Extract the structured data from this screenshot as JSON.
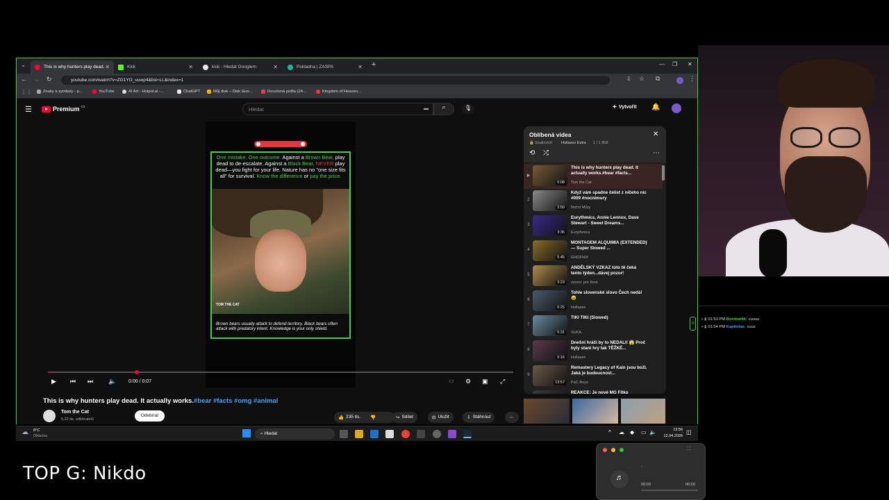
{
  "browser": {
    "tabs": [
      {
        "label": "This is why hunters play dead. ",
        "color": "#ff0033",
        "active": true
      },
      {
        "label": "Kick",
        "color": "#53fc18",
        "active": false
      },
      {
        "label": "kick - Hledat Googlem",
        "color": "#e8e8e8",
        "active": false
      },
      {
        "label": "Pokladna | ZASPA",
        "color": "#1fb0a8",
        "active": false
      }
    ],
    "new_tab_label": "+",
    "url": "youtube.com/watch?v=ZG1YO_uuwp4&list=LL&index=1",
    "bookmarks": [
      "Znaky a symboly - p...",
      "YouTube",
      "AI Art - Hotpot.ai -...",
      "ChatGPT",
      "Můj disk – Disk Goo...",
      "Doručená pošta (24...",
      "Kingdom of Heaven..."
    ]
  },
  "youtube": {
    "logo_text": "Premium",
    "logo_superscript": "CZ",
    "search_placeholder": "Hledat",
    "create_label": "Vytvořit",
    "video": {
      "overlay_text_1": "One mistake. One outcome.",
      "overlay_text_2": " Against a ",
      "overlay_text_3": "Brown Bear,",
      "overlay_text_4": " play dead to de-escalate. Against a ",
      "overlay_text_5": "Black Bear,",
      "overlay_text_6": " NEVER",
      "overlay_text_7": " play dead—you fight for your life. Nature has no \"one size fits all\" for survival. ",
      "overlay_text_8": "Know the difference",
      "overlay_text_9": " or ",
      "overlay_text_10": "pay the price.",
      "watermark": "TOM THE CAT",
      "caption": "Brown bears usually attack to defend territory. Black bears often attack with predatory intent. Knowledge is your only shield.",
      "time": "0:00 / 0:07",
      "progress_fraction": 0.005
    },
    "title_main": "This is why hunters play dead. It actually works.",
    "title_tags": "#bear #facts #omg #animal",
    "channel_name": "Tom the Cat",
    "subscribers": "5,22 tis. odběratelů",
    "subscribe_label": "Odebírat",
    "likes": "235 tis.",
    "share_label": "Sdílet",
    "save_label": "Uložit",
    "download_label": "Stáhnout"
  },
  "playlist": {
    "title": "Oblíbená videa",
    "privacy": "Soukromé",
    "owner": "Hollasen Extra",
    "position": "1 / 1 858",
    "items": [
      {
        "idx": "▶",
        "title": "This is why hunters play dead. It actually works.#bear #facts...",
        "channel": "Tom the Cat",
        "duration": "0:08",
        "color": "#7a5a3a"
      },
      {
        "idx": "2",
        "title": "Když vám spadne čelist z ničeho nic #009 #nocnimury",
        "channel": "Noční Můry",
        "duration": "2:50",
        "color": "#8a8a8a"
      },
      {
        "idx": "3",
        "title": "Eurythmics, Annie Lennox, Dave Stewart - Sweet Dreams...",
        "channel": "Eurythmics",
        "duration": "3:35",
        "color": "#3a2a8a"
      },
      {
        "idx": "4",
        "title": "MONTAGEM ALQUIMIA (EXTENDED) — Super Slowed ...",
        "channel": "GHOFNIX",
        "duration": "5:45",
        "color": "#8a6a2a"
      },
      {
        "idx": "5",
        "title": "ANDĚLSKÝ VZKAZ toto tě čeká tento týden...dávej pozor!",
        "channel": "vzorec pro život",
        "duration": "3:23",
        "color": "#b08a4a"
      },
      {
        "idx": "6",
        "title": "Tohle slovenské slovo Čech nedá! 😅",
        "channel": "Hollasen",
        "duration": "0:25",
        "color": "#4a5a6a"
      },
      {
        "idx": "7",
        "title": "TIKI TIKI (Slowed)",
        "channel": "SUKA.",
        "duration": "5:31",
        "color": "#6a8aa0"
      },
      {
        "idx": "8",
        "title": "Dnešní hráči by to NEDALI! 😱 Proč byly staré hry tak TĚŽKÉ...",
        "channel": "Hollasen",
        "duration": "0:16",
        "color": "#5a3a4a"
      },
      {
        "idx": "9",
        "title": "Remastery Legacy of Kain jsou boží. Jaká je budoucnost...",
        "channel": "PaC-Boys",
        "duration": "13:57",
        "color": "#6a5a4a"
      },
      {
        "idx": "10",
        "title": "REAKCE: Je nové MG Fitko",
        "channel": "",
        "duration": "",
        "color": "#3a3a3a"
      }
    ]
  },
  "taskbar": {
    "weather_temp": "8°C",
    "weather_text": "Oblačno",
    "search_label": "Hledat",
    "time": "13:56",
    "date": "12.04.2026"
  },
  "chat": {
    "lines": [
      {
        "time": "01:53 PM",
        "user": "Bombarkk:",
        "msg": "vuuuu",
        "color": "#3ad34a"
      },
      {
        "time": "01:54 PM",
        "user": "Kapitolas:",
        "msg": "cuus",
        "color": "#3ea6ff"
      }
    ]
  },
  "overlay_label": "TOP G: Nikdo",
  "miniplayer": {
    "time_start": "00:00",
    "time_end": "00:00",
    "track": "-"
  },
  "colors": {
    "accent_green": "#3ad34a",
    "yt_red": "#ff0033",
    "link_blue": "#3ea6ff"
  }
}
